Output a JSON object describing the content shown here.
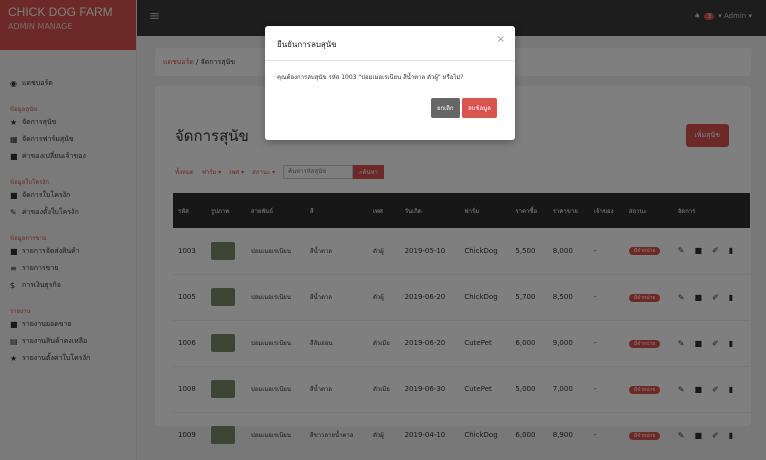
{
  "brand": {
    "name": "CHICK DOG FARM",
    "sub": "ADMIN MANAGE"
  },
  "sidebar": {
    "dashboard": "แดชบอร์ด",
    "groups": [
      {
        "head": "ข้อมูลสุนัข",
        "items": [
          {
            "icon": "trophy-icon",
            "glyph": "★",
            "label": "จัดการสุนัข"
          },
          {
            "icon": "calendar-icon",
            "glyph": "▦",
            "label": "จัดการฟาร์มสุนัข"
          },
          {
            "icon": "book-icon",
            "glyph": "■",
            "label": "ค่าของเปลี่ยนเจ้าของ"
          }
        ]
      },
      {
        "head": "ข้อมูลใบโครงัก",
        "items": [
          {
            "icon": "book-icon",
            "glyph": "■",
            "label": "จัดการใบโครงัก"
          },
          {
            "icon": "pencil-icon",
            "glyph": "✎",
            "label": "ค่าของตั้งใบโครงัก"
          }
        ]
      },
      {
        "head": "ข้อมูลการขาย",
        "items": [
          {
            "icon": "truck-icon",
            "glyph": "■",
            "label": "รายการจัดส่งสินค้า"
          },
          {
            "icon": "money-icon",
            "glyph": "≡",
            "label": "รายการขาย"
          },
          {
            "icon": "dollar-icon",
            "glyph": "$",
            "label": "การเงินธุรกิจ"
          }
        ]
      },
      {
        "head": "รายงาน",
        "items": [
          {
            "icon": "book-icon",
            "glyph": "■",
            "label": "รายงานยอดขาย"
          },
          {
            "icon": "list-icon",
            "glyph": "▤",
            "label": "รายงานสินค้าคงเหลือ"
          },
          {
            "icon": "star-icon",
            "glyph": "★",
            "label": "รายงานตั้งค่าใบโครงัก"
          }
        ]
      }
    ]
  },
  "topbar": {
    "badge": "3",
    "admin": "Admin"
  },
  "breadcrumb": {
    "home": "แดชบอร์ด",
    "current": "จัดการสุนัข"
  },
  "page": {
    "title": "จัดการสุนัข",
    "add_label": "เพิ่มสุนัข"
  },
  "filters": {
    "all": "ทั้งหมด",
    "farm": "ฟาร์ม",
    "sex": "เพศ",
    "status": "สถานะ",
    "search_placeholder": "ค้นหารหัสสุนัข",
    "search_btn": "ค้นหา"
  },
  "table": {
    "headers": [
      "รหัส",
      "รูปภาพ",
      "สายพันธ์",
      "สี",
      "เพศ",
      "วันเกิด",
      "ฟาร์ม",
      "ราคาซื้อ",
      "ราคาขาย",
      "เจ้าของ",
      "สถานะ",
      "จัดการ"
    ],
    "rows": [
      {
        "id": "1003",
        "breed": "ปอมเมอเรเนียน",
        "color": "สีน้ำตาล",
        "sex": "ตัวผู้",
        "dob": "2019-05-10",
        "farm": "ChickDog",
        "buy": "5,500",
        "sell": "8,000",
        "owner": "-",
        "status": "มีจำหน่าย"
      },
      {
        "id": "1005",
        "breed": "ปอมเมอเรเนียน",
        "color": "สีน้ำตาล",
        "sex": "ตัวผู้",
        "dob": "2019-06-20",
        "farm": "ChickDog",
        "buy": "5,700",
        "sell": "8,500",
        "owner": "-",
        "status": "มีจำหน่าย"
      },
      {
        "id": "1006",
        "breed": "ปอมเมอเรเนียน",
        "color": "สีส้มอ่อน",
        "sex": "ตัวเมีย",
        "dob": "2019-06-20",
        "farm": "CutePet",
        "buy": "6,000",
        "sell": "9,000",
        "owner": "-",
        "status": "มีจำหน่าย"
      },
      {
        "id": "1008",
        "breed": "ปอมเมอเรเนียน",
        "color": "สีน้ำตาล",
        "sex": "ตัวเมีย",
        "dob": "2019-06-30",
        "farm": "CutePet",
        "buy": "5,000",
        "sell": "7,000",
        "owner": "-",
        "status": "มีจำหน่าย"
      },
      {
        "id": "1009",
        "breed": "ปอมเมอเรเนียน",
        "color": "สีขาวลายน้ำตาล",
        "sex": "ตัวผู้",
        "dob": "2019-04-10",
        "farm": "ChickDog",
        "buy": "6,000",
        "sell": "8,900",
        "owner": "-",
        "status": "มีจำหน่าย"
      }
    ]
  },
  "modal": {
    "title": "ยืนยันการลบสุนัข",
    "message": "คุณต้องการลบสุนัข รหัส 1003 \"ปอมเมอเรเนียน สีน้ำตาล ตัวผู้\" หรือไม่?",
    "cancel": "ยกเลิก",
    "confirm": "ลบข้อมูล"
  }
}
